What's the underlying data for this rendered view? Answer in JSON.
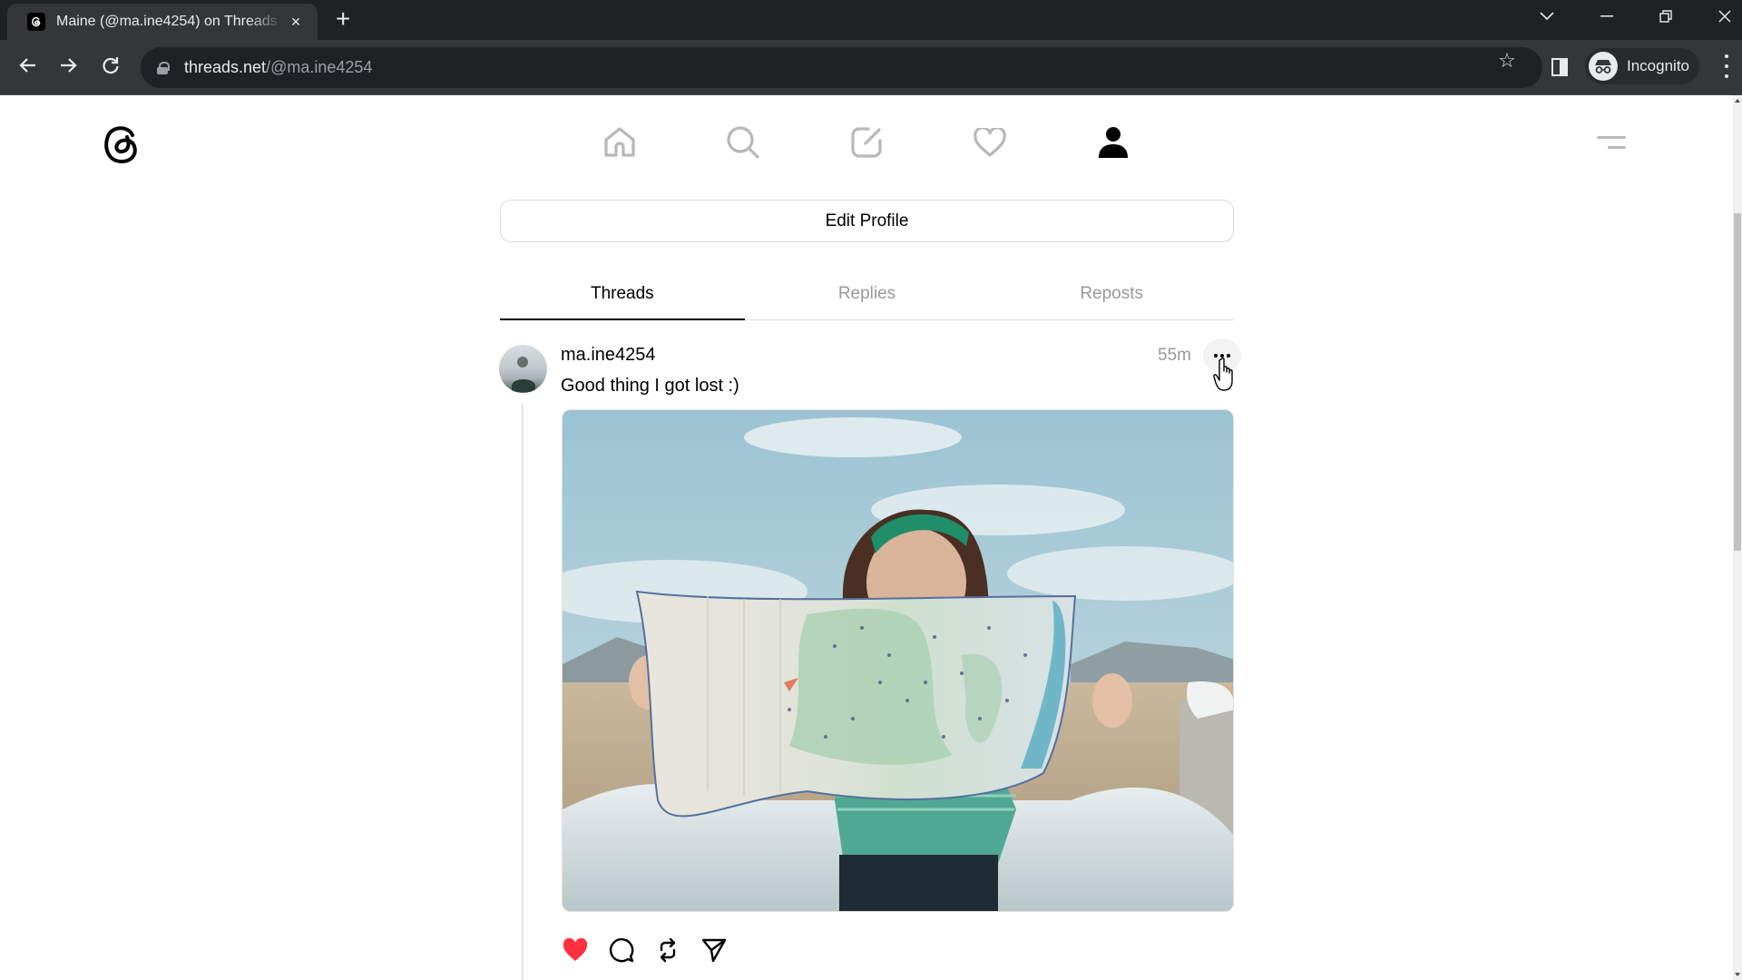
{
  "browser": {
    "tab": {
      "title": "Maine (@ma.ine4254) on Threads",
      "favicon": "threads-icon",
      "close_label": "×"
    },
    "new_tab_label": "+",
    "address": {
      "host": "threads.net",
      "path": "/@ma.ine4254"
    },
    "incognito_label": "Incognito"
  },
  "app": {
    "nav": [
      {
        "icon": "home-icon",
        "active": false
      },
      {
        "icon": "search-icon",
        "active": false
      },
      {
        "icon": "compose-icon",
        "active": false
      },
      {
        "icon": "heart-icon",
        "active": false
      },
      {
        "icon": "profile-icon",
        "active": true
      }
    ],
    "edit_profile_label": "Edit Profile",
    "tabs": [
      {
        "label": "Threads",
        "active": true
      },
      {
        "label": "Replies",
        "active": false
      },
      {
        "label": "Reposts",
        "active": false
      }
    ],
    "post": {
      "username": "ma.ine4254",
      "time": "55m",
      "text": "Good thing I got lost :)",
      "image_description": "Woman with green headband holding up a large unfolded road map in front of her face, blue sky with clouds and mountains behind, leaning on a white car",
      "liked": true,
      "actions": [
        "like-icon",
        "comment-icon",
        "repost-icon",
        "share-icon"
      ]
    },
    "colors": {
      "like_red": "#ff3040",
      "inactive_icon": "#b8b8b8",
      "muted_text": "#999999"
    }
  }
}
